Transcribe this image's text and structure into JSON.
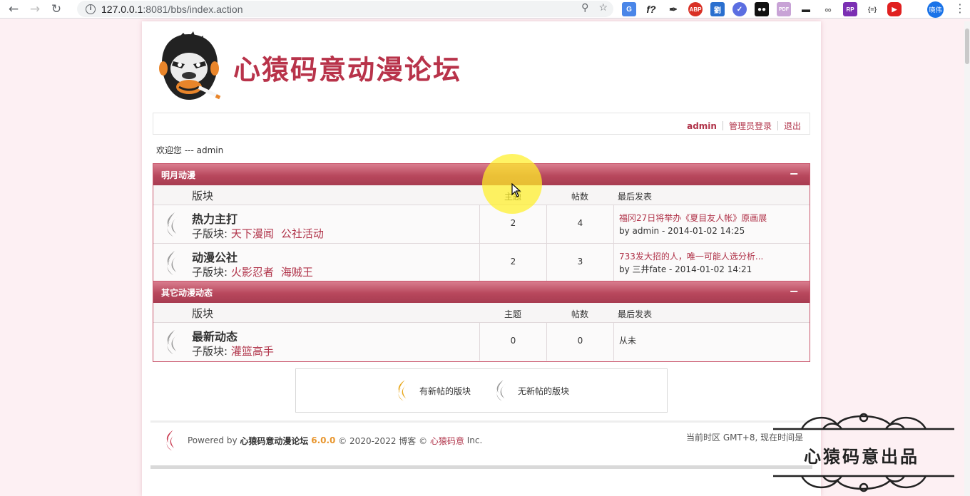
{
  "browser": {
    "url_host": "127.0.0.1",
    "url_rest": ":8081/bbs/index.action",
    "profile_name": "晓伟"
  },
  "site": {
    "title": "心猿码意动漫论坛",
    "userbar": {
      "user": "admin",
      "admin_login": "管理员登录",
      "logout": "退出"
    },
    "welcome": "欢迎您 --- admin"
  },
  "columns": {
    "board": "版块",
    "topics": "主题",
    "posts": "帖数",
    "last": "最后发表"
  },
  "categories": [
    {
      "name": "明月动漫",
      "toggle": "−",
      "boards": [
        {
          "name": "热力主打",
          "subs_label": "子版块:",
          "subs": [
            "天下漫闻",
            "公社活动"
          ],
          "topics": "2",
          "posts": "4",
          "last_title": "福冈27日将举办《夏目友人帐》原画展",
          "last_by": "by admin - 2014-01-02 14:25"
        },
        {
          "name": "动漫公社",
          "subs_label": "子版块:",
          "subs": [
            "火影忍者",
            "海贼王"
          ],
          "topics": "2",
          "posts": "3",
          "last_title": "733发大招的人，唯一可能人选分析...",
          "last_by": "by 三井fate - 2014-01-02 14:21"
        }
      ]
    },
    {
      "name": "其它动漫动态",
      "toggle": "−",
      "boards": [
        {
          "name": "最新动态",
          "subs_label": "子版块:",
          "subs": [
            "灌篮高手"
          ],
          "topics": "0",
          "posts": "0",
          "last_never": "从未"
        }
      ]
    }
  ],
  "legend": {
    "new": "有新帖的版块",
    "none": "无新帖的版块"
  },
  "footer": {
    "powered": "Powered by",
    "forum_name": "心猿码意动漫论坛",
    "version": "6.0.0",
    "copyright": "© 2020-2022 博客 ©",
    "company": "心猿码意",
    "inc": "Inc.",
    "timezone": "当前时区 GMT+8, 现在时间是"
  },
  "watermark": "心猿码意出品",
  "colors": {
    "accent": "#b03349",
    "category_bar": "#b8485d",
    "legend_new": "#e8a81e",
    "legend_none": "#9b9b9b"
  }
}
